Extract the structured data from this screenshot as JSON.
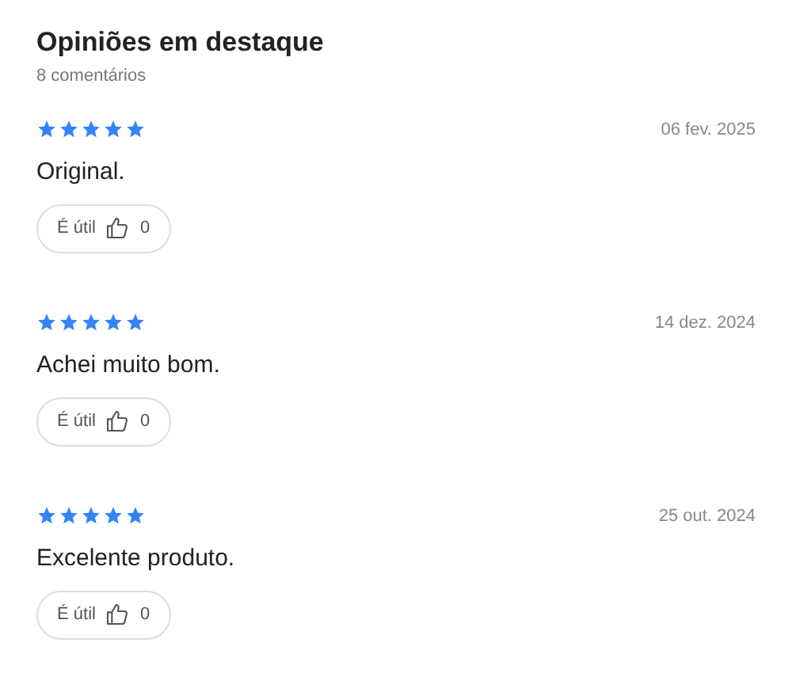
{
  "title": "Opiniões em destaque",
  "count": "8 comentários",
  "reviews": [
    {
      "stars": 5,
      "date": "06 fev. 2025",
      "text": "Original.",
      "helpful_label": "É útil",
      "helpful_count": "0"
    },
    {
      "stars": 5,
      "date": "14 dez. 2024",
      "text": "Achei muito bom.",
      "helpful_label": "É útil",
      "helpful_count": "0"
    },
    {
      "stars": 5,
      "date": "25 out. 2024",
      "text": "Excelente produto.",
      "helpful_label": "É útil",
      "helpful_count": "0"
    }
  ]
}
